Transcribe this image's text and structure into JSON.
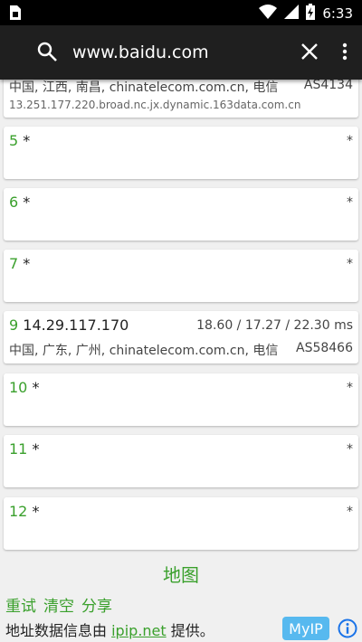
{
  "status_bar": {
    "time": "6:33",
    "icons": [
      "sim-icon",
      "wifi-icon",
      "signal-icon",
      "battery-charging-icon"
    ]
  },
  "toolbar": {
    "url": "www.baidu.com",
    "icons": [
      "search-icon",
      "close-icon",
      "more-vert-icon"
    ]
  },
  "hops": [
    {
      "num": "",
      "ip": "",
      "location": "中国, 江西, 南昌, chinatelecom.com.cn, 电信",
      "asn": "AS4134",
      "hostname": "13.251.177.220.broad.nc.jx.dynamic.163data.com.cn"
    },
    {
      "num": "5",
      "ip": "*",
      "rtt": "*"
    },
    {
      "num": "6",
      "ip": "*",
      "rtt": "*"
    },
    {
      "num": "7",
      "ip": "*",
      "rtt": "*"
    },
    {
      "num": "9",
      "ip": "14.29.117.170",
      "rtt": "18.60 / 17.27 / 22.30 ms",
      "location": "中国, 广东, 广州, chinatelecom.com.cn, 电信",
      "asn": "AS58466"
    },
    {
      "num": "10",
      "ip": "*",
      "rtt": "*"
    },
    {
      "num": "11",
      "ip": "*",
      "rtt": "*"
    },
    {
      "num": "12",
      "ip": "*",
      "rtt": "*"
    }
  ],
  "footer": {
    "map_label": "地图",
    "retry_label": "重试",
    "clear_label": "清空",
    "share_label": "分享",
    "provider_prefix": "地址数据信息由",
    "provider_link": "ipip.net",
    "provider_suffix": "提供。",
    "myip_label": "MyIP"
  },
  "colors": {
    "accent_green": "#3aa02c",
    "toolbar_bg": "#1f1f1f",
    "myip_bg": "#57b9ef",
    "info_blue": "#1a73e8"
  }
}
